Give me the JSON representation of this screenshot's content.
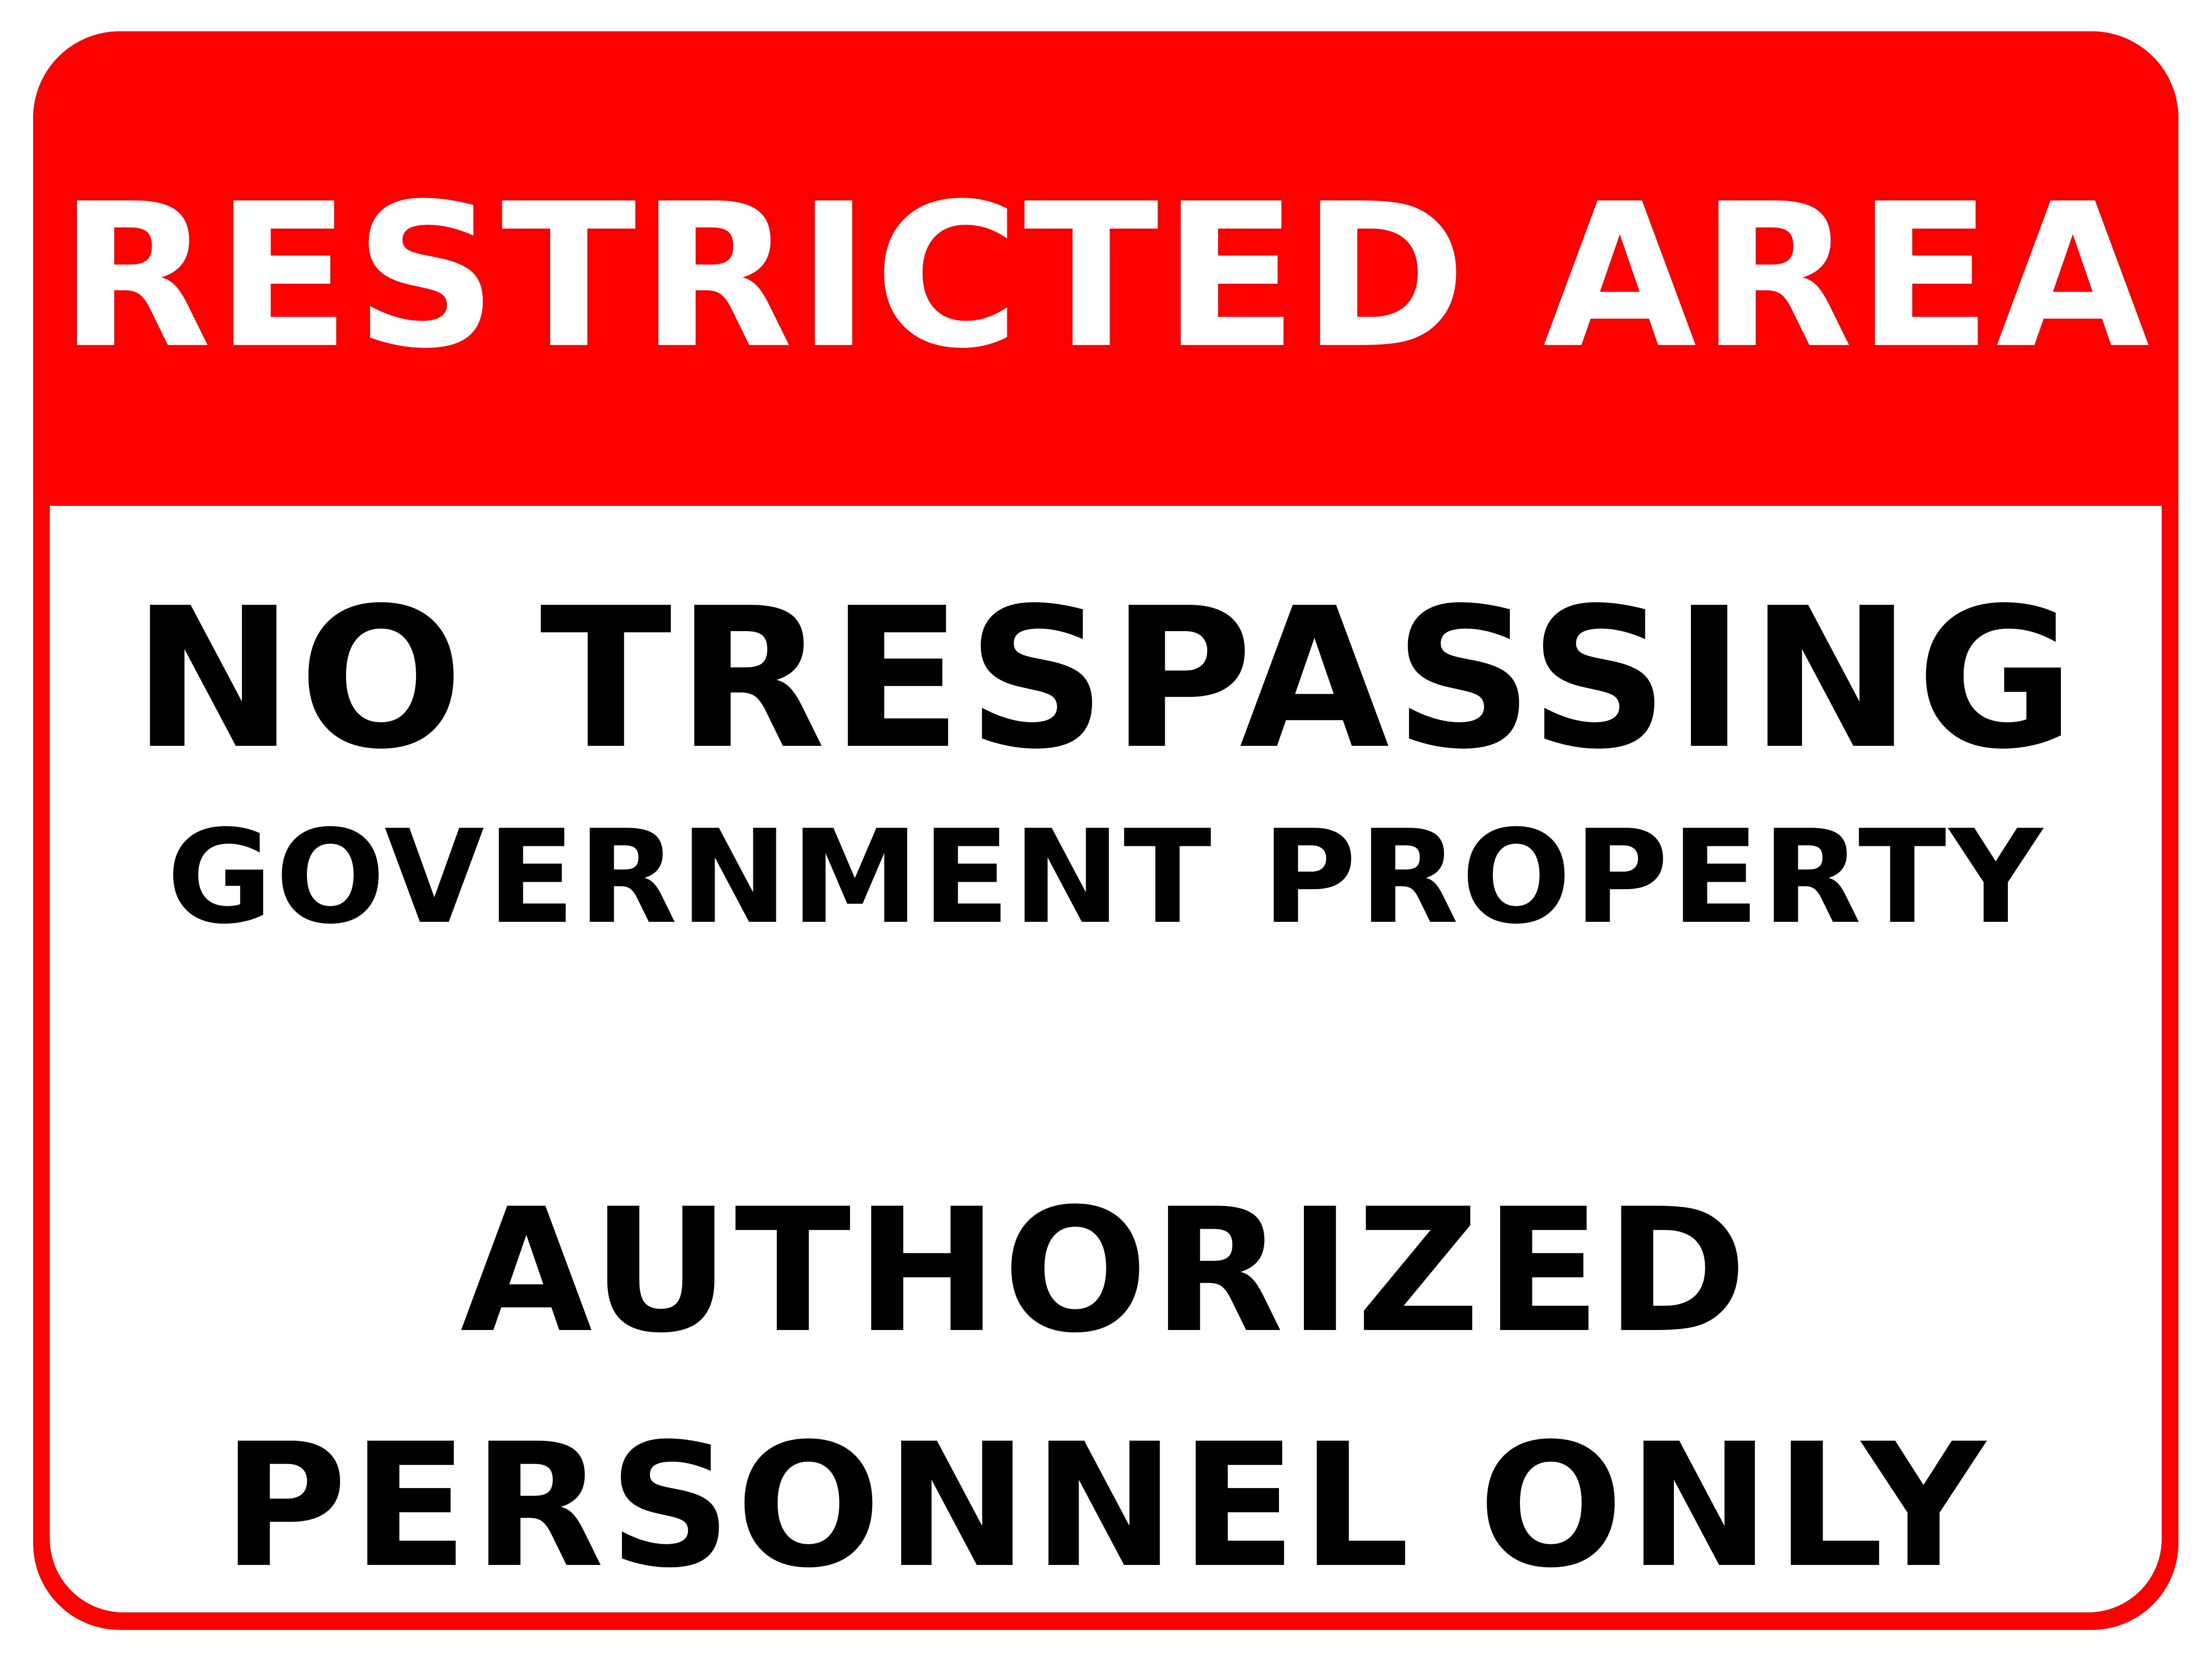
{
  "colors": {
    "sign_red": "#ff0000",
    "background": "#ffffff",
    "header_text": "#ffffff",
    "body_text": "#000000"
  },
  "header": {
    "title": "RESTRICTED AREA"
  },
  "body": {
    "line_1": "NO TRESPASSING",
    "line_2": "GOVERNMENT PROPERTY",
    "line_3": "AUTHORIZED",
    "line_4": "PERSONNEL ONLY"
  }
}
